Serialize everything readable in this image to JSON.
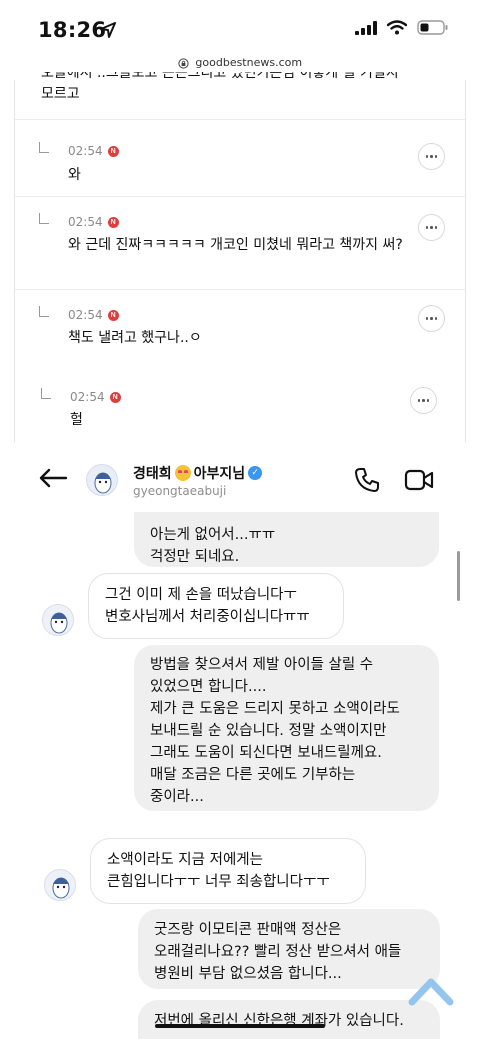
{
  "status_bar": {
    "time": "18:26",
    "url": "goodbestnews.com"
  },
  "article": {
    "cut_text_line1": "오늘에서 ..그을보고 든든그리고 있던기븐님 이놓게 될 기일지",
    "cut_text_line2": "모르고",
    "comments": [
      {
        "time": "02:54",
        "badge": "N",
        "text": "와"
      },
      {
        "time": "02:54",
        "badge": "N",
        "text": "와 근데 진짜ㅋㅋㅋㅋㅋ 개코인 미쳤네 뭐라고 책까지 써?"
      },
      {
        "time": "02:54",
        "badge": "N",
        "text": "책도 낼려고 했구나..ㅇ"
      },
      {
        "time": "02:54",
        "badge": "N",
        "text": "헐"
      }
    ]
  },
  "instagram": {
    "profile_name": "경태희",
    "profile_name_suffix": "아부지님",
    "handle": "gyeongtaeabuji",
    "messages": [
      {
        "dir": "out",
        "text": "아는게 없어서...ㅠㅠ\n걱정만 되네요."
      },
      {
        "dir": "in",
        "text": "그건 이미 제 손을 떠났습니다ㅜ\n변호사님께서 처리중이십니다ㅠㅠ"
      },
      {
        "dir": "out",
        "text": "방법을 찾으셔서 제발 아이들 살릴 수\n있었으면 합니다....\n제가 큰 도움은 드리지 못하고 소액이라도\n보내드릴 순 있습니다. 정말 소액이지만\n그래도 도움이 되신다면 보내드릴께요.\n매달 조금은 다른 곳에도 기부하는\n중이라..."
      },
      {
        "dir": "in",
        "text": "소액이라도 지금 저에게는\n큰힘입니다ㅜㅜ 너무 죄송합니다ㅜㅜ"
      },
      {
        "dir": "out",
        "text": "굿즈랑 이모티콘 판매액 정산은\n오래걸리나요?? 빨리 정산 받으셔서 애들\n병원비 부담 없으셨음 합니다..."
      },
      {
        "dir": "out",
        "text": "저번에 올리신 신한은행 계좌가 있습니다."
      }
    ]
  },
  "colors": {
    "badge": "#e03d3d",
    "verified": "#3897f0",
    "bubble_out": "#efefef",
    "scroll_top": "#8ec3ec"
  }
}
